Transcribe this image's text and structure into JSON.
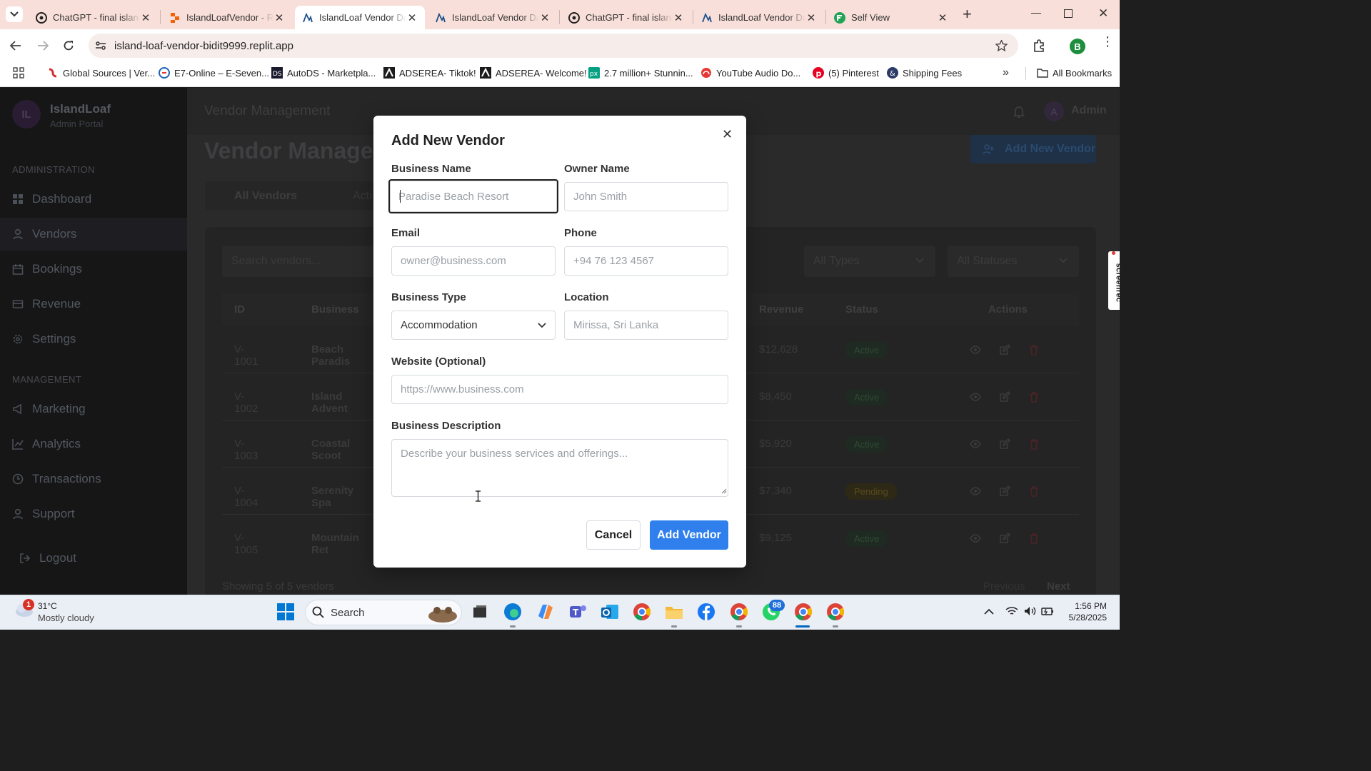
{
  "browser": {
    "tabs": [
      {
        "title": "ChatGPT - final islanc"
      },
      {
        "title": "IslandLoafVendor - R"
      },
      {
        "title": "IslandLoaf Vendor Da"
      },
      {
        "title": "IslandLoaf Vendor Da"
      },
      {
        "title": "ChatGPT - final islanc"
      },
      {
        "title": "IslandLoaf Vendor Da"
      },
      {
        "title": "Self View"
      }
    ],
    "url": "island-loaf-vendor-bidit9999.replit.app",
    "profile_initial": "B",
    "bookmarks": [
      {
        "label": "Global Sources | Ver..."
      },
      {
        "label": "E7-Online – E-Seven..."
      },
      {
        "label": "AutoDS - Marketpla..."
      },
      {
        "label": "ADSEREA- Tiktok!"
      },
      {
        "label": "ADSEREA- Welcome!"
      },
      {
        "label": "2.7 million+ Stunnin..."
      },
      {
        "label": "YouTube Audio Do..."
      },
      {
        "label": "(5) Pinterest"
      },
      {
        "label": "Shipping Fees"
      }
    ],
    "all_bookmarks": "All Bookmarks"
  },
  "sidebar": {
    "logo_initials": "IL",
    "brand": "IslandLoaf",
    "subtitle": "Admin Portal",
    "section_admin": "ADMINISTRATION",
    "section_mgmt": "MANAGEMENT",
    "items_admin": [
      {
        "label": "Dashboard",
        "icon": "grid-icon"
      },
      {
        "label": "Vendors",
        "icon": "user-icon"
      },
      {
        "label": "Bookings",
        "icon": "calendar-icon"
      },
      {
        "label": "Revenue",
        "icon": "wallet-icon"
      },
      {
        "label": "Settings",
        "icon": "gear-icon"
      }
    ],
    "items_mgmt": [
      {
        "label": "Marketing",
        "icon": "megaphone-icon"
      },
      {
        "label": "Analytics",
        "icon": "chart-icon"
      },
      {
        "label": "Transactions",
        "icon": "clock-icon"
      },
      {
        "label": "Support",
        "icon": "user-icon"
      }
    ],
    "logout": "Logout"
  },
  "header": {
    "title": "Vendor Management",
    "user_initial": "A",
    "user_name": "Admin"
  },
  "page": {
    "title": "Vendor Managem",
    "add_button": "Add New Vendor",
    "tab_all": "All Vendors",
    "tab_active": "Acti",
    "search_placeholder": "Search vendors...",
    "filter_types": "All Types",
    "filter_statuses": "All Statuses",
    "columns": {
      "id": "ID",
      "business": "Business",
      "revenue": "Revenue",
      "status": "Status",
      "actions": "Actions"
    },
    "rows": [
      {
        "id": "V-1001",
        "business": "Beach Paradis",
        "revenue": "$12,628",
        "status": "Active"
      },
      {
        "id": "V-1002",
        "business": "Island Advent",
        "revenue": "$8,450",
        "status": "Active"
      },
      {
        "id": "V-1003",
        "business": "Coastal Scoot",
        "revenue": "$5,920",
        "status": "Active"
      },
      {
        "id": "V-1004",
        "business": "Serenity Spa",
        "revenue": "$7,340",
        "status": "Pending"
      },
      {
        "id": "V-1005",
        "business": "Mountain Ret",
        "revenue": "$9,125",
        "status": "Active"
      }
    ],
    "showing": "Showing 5 of 5 vendors",
    "prev": "Previous",
    "next": "Next"
  },
  "modal": {
    "title": "Add New Vendor",
    "business_name_label": "Business Name",
    "business_name_placeholder": "Paradise Beach Resort",
    "owner_name_label": "Owner Name",
    "owner_name_placeholder": "John Smith",
    "email_label": "Email",
    "email_placeholder": "owner@business.com",
    "phone_label": "Phone",
    "phone_placeholder": "+94 76 123 4567",
    "business_type_label": "Business Type",
    "business_type_value": "Accommodation",
    "location_label": "Location",
    "location_placeholder": "Mirissa, Sri Lanka",
    "website_label": "Website (Optional)",
    "website_placeholder": "https://www.business.com",
    "description_label": "Business Description",
    "description_placeholder": "Describe your business services and offerings...",
    "cancel": "Cancel",
    "submit": "Add Vendor"
  },
  "screenrec": "screenrec",
  "taskbar": {
    "weather_temp": "31°C",
    "weather_desc": "Mostly cloudy",
    "weather_badge": "1",
    "search": "Search",
    "whatsapp_badge": "88",
    "time": "1:56 PM",
    "date": "5/28/2025"
  },
  "colors": {
    "accent": "#2f80ed",
    "active_green": "#2e6b3e",
    "pending_amber": "#7a5a12"
  }
}
